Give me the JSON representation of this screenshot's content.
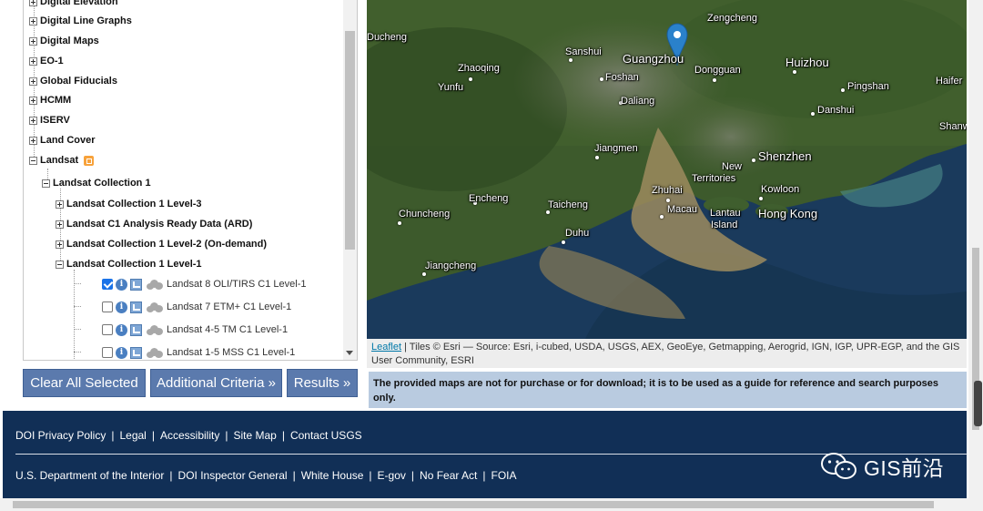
{
  "tree": {
    "top_nodes": [
      {
        "label": "Digital Elevation"
      },
      {
        "label": "Digital Line Graphs"
      },
      {
        "label": "Digital Maps"
      },
      {
        "label": "EO-1"
      },
      {
        "label": "Global Fiducials"
      },
      {
        "label": "HCMM"
      },
      {
        "label": "ISERV"
      },
      {
        "label": "Land Cover"
      },
      {
        "label": "Landsat"
      }
    ],
    "landsat_collection": "Landsat Collection 1",
    "sub_nodes": [
      {
        "label": "Landsat Collection 1 Level-3"
      },
      {
        "label": "Landsat C1 Analysis Ready Data (ARD)"
      },
      {
        "label": "Landsat Collection 1 Level-2 (On-demand)"
      },
      {
        "label": "Landsat Collection 1 Level-1"
      }
    ],
    "datasets": [
      {
        "label": "Landsat 8 OLI/TIRS C1 Level-1",
        "checked": true
      },
      {
        "label": "Landsat 7 ETM+ C1 Level-1",
        "checked": false
      },
      {
        "label": "Landsat 4-5 TM C1 Level-1",
        "checked": false
      },
      {
        "label": "Landsat 1-5 MSS C1 Level-1",
        "checked": false
      }
    ]
  },
  "buttons": {
    "clear": "Clear All Selected",
    "criteria": "Additional Criteria »",
    "results": "Results »"
  },
  "map": {
    "labels": {
      "zengcheng": "Zengcheng",
      "ducheng": "Ducheng",
      "sanshui": "Sanshui",
      "guangzhou": "Guangzhou",
      "huizhou": "Huizhou",
      "haifeng": "Haifer",
      "zhaoqing": "Zhaoqing",
      "foshan": "Foshan",
      "dongguan": "Dongguan",
      "pingshan": "Pingshan",
      "yunfu": "Yunfu",
      "daliang": "Daliang",
      "danshui": "Danshui",
      "shanwei": "Shanwe",
      "jiangmen": "Jiangmen",
      "shenzhen": "Shenzhen",
      "new_territories_1": "New",
      "new_territories_2": "Territories",
      "zhuhai": "Zhuhai",
      "kowloon": "Kowloon",
      "encheng": "Encheng",
      "taicheng": "Taicheng",
      "macau": "Macau",
      "lantau_1": "Lantau",
      "lantau_2": "Island",
      "hong_kong": "Hong Kong",
      "chuncheng": "Chuncheng",
      "duhu": "Duhu",
      "jiangcheng": "Jiangcheng"
    },
    "attribution_link": "Leaflet",
    "attribution_text": "| Tiles © Esri — Source: Esri, i-cubed, USDA, USGS, AEX, GeoEye, Getmapping, Aerogrid, IGN, IGP, UPR-EGP, and the GIS User Community, ESRI"
  },
  "disclaimer": "The provided maps are not for purchase or for download; it is to be used as a guide for reference and search purposes only.",
  "footer": {
    "row1": [
      "DOI Privacy Policy",
      "Legal",
      "Accessibility",
      "Site Map",
      "Contact USGS"
    ],
    "row2": [
      "U.S. Department of the Interior",
      "DOI Inspector General",
      "White House",
      "E-gov",
      "No Fear Act",
      "FOIA"
    ],
    "separator": "|"
  },
  "watermark": "GIS前沿",
  "colors": {
    "button": "#5b7aad",
    "footer": "#112f56",
    "disclaimer_bg": "#b9cbe0",
    "map_pin": "#2a81cb"
  }
}
